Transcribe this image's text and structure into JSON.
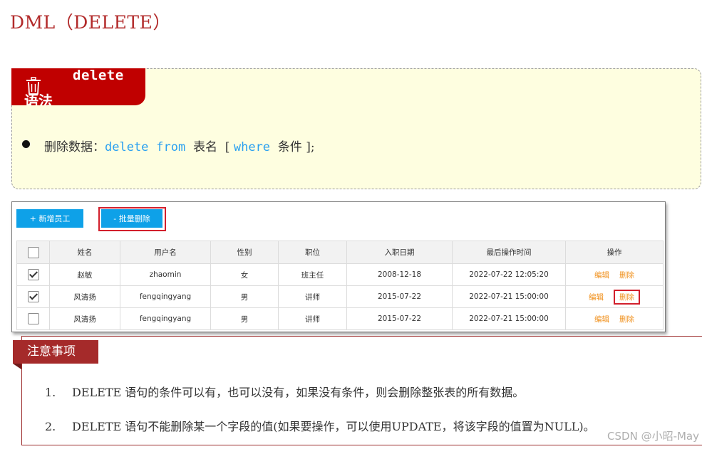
{
  "page_title": "DML（DELETE）",
  "syntax_box": {
    "tab_title": "delete",
    "tab_subtitle": "语法",
    "icon": "trash-icon",
    "line": {
      "prefix": "删除数据：",
      "kw1": "delete",
      "kw2": "from",
      "table": "表名",
      "bracket_open": "[",
      "kw3": "where",
      "cond": "条件",
      "bracket_close": "];"
    }
  },
  "app": {
    "add_button": "+ 新增员工",
    "batch_delete_button": "- 批量删除",
    "columns": [
      "",
      "姓名",
      "用户名",
      "性别",
      "职位",
      "入职日期",
      "最后操作时间",
      "操作"
    ],
    "rows": [
      {
        "checked": true,
        "name": "赵敏",
        "username": "zhaomin",
        "gender": "女",
        "position": "班主任",
        "entry_date": "2008-12-18",
        "last_op": "2022-07-22 12:05:20",
        "edit": "编辑",
        "delete": "删除"
      },
      {
        "checked": true,
        "name": "风清扬",
        "username": "fengqingyang",
        "gender": "男",
        "position": "讲师",
        "entry_date": "2015-07-22",
        "last_op": "2022-07-21 15:00:00",
        "edit": "编辑",
        "delete": "删除"
      },
      {
        "checked": false,
        "name": "风清扬",
        "username": "fengqingyang",
        "gender": "男",
        "position": "讲师",
        "entry_date": "2015-07-22",
        "last_op": "2022-07-21 15:00:00",
        "edit": "编辑",
        "delete": "删除"
      }
    ],
    "highlight_color": "#d21f2c",
    "button_color": "#0ea1e8",
    "action_color": "#f0901c"
  },
  "notes": {
    "title": "注意事项",
    "items": [
      {
        "num": "1.",
        "text": "DELETE 语句的条件可以有，也可以没有，如果没有条件，则会删除整张表的所有数据。"
      },
      {
        "num": "2.",
        "text": "DELETE 语句不能删除某一个字段的值(如果要操作，可以使用UPDATE，将该字段的值置为NULL)。"
      }
    ]
  },
  "watermark": "CSDN @小昭-May"
}
